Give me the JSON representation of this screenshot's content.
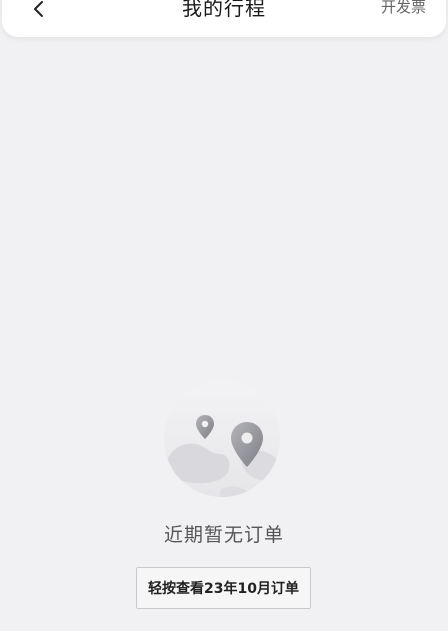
{
  "header": {
    "title": "我的行程",
    "invoice_label": "开发票",
    "back_icon": "chevron-left-icon"
  },
  "empty_state": {
    "illustration_icon": "map-pin-globe-icon",
    "message": "近期暂无订单",
    "history_button_label": "轻按查看23年10月订单"
  },
  "colors": {
    "background": "#f1f1f3",
    "header": "#ffffff",
    "text_primary": "#1a1a1a",
    "text_secondary": "#666666"
  }
}
